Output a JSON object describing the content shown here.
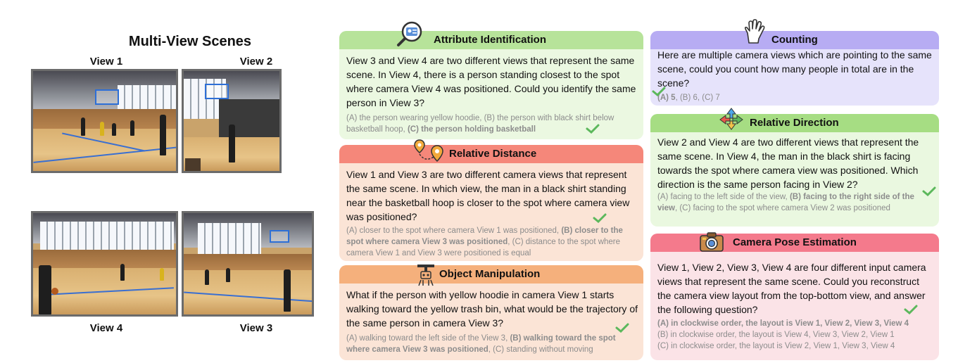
{
  "scenes": {
    "title": "Multi-View Scenes",
    "view1": "View 1",
    "view2": "View 2",
    "view3": "View 3",
    "view4": "View 4"
  },
  "colors": {
    "attribute_header": "#b7e39a",
    "distance_header": "#f5877a",
    "manipulation_header": "#f5b07c",
    "counting_header": "#b7acf3",
    "direction_header": "#a6dd83",
    "camera_header": "#f47a8c",
    "check": "#5cb85c"
  },
  "icons": {
    "attribute": "magnifier-id-card-icon",
    "distance": "map-pins-icon",
    "manipulation": "robot-arm-icon",
    "counting": "hand-counting-icon",
    "direction": "direction-arrows-icon",
    "camera": "camera-icon",
    "answer_marker": "check-icon"
  },
  "cards": {
    "attribute": {
      "title": "Attribute Identification",
      "question": "View 3 and View 4 are two different views that represent the same scene. In View 4, there is a person standing closest to the spot where camera View 4 was positioned. Could you identify the same person in View 3?",
      "opt_a": "(A) the person wearing yellow hoodie, (B) the person with black shirt below basketball hoop, ",
      "opt_c": "(C) the person holding basketball"
    },
    "distance": {
      "title": "Relative Distance",
      "question": "View 1 and View 3 are two different camera views that represent the same scene. In which view, the man in a black shirt standing near the basketball hoop is closer to the spot where camera view was positioned?",
      "opt_a": "(A) closer to the spot where camera View 1 was positioned, ",
      "opt_b": "(B) closer to the spot where camera View 3 was positioned",
      "opt_c": ", (C) distance to the spot where camera View 1 and View 3 were positioned is equal"
    },
    "manipulation": {
      "title": "Object Manipulation",
      "question": "What if the person with yellow hoodie in camera View 1 starts walking toward the yellow trash bin, what would be the trajectory of the same person in camera View 3?",
      "opt_a": "(A) walking toward the left side of the View 3, ",
      "opt_b": "(B) walking toward the spot where camera View 3 was positioned",
      "opt_c": ", (C) standing without moving"
    },
    "counting": {
      "title": "Counting",
      "question": "Here are multiple camera views which are pointing to the same scene, could you count how many people in total are in the scene?",
      "opt_a": "(A) 5",
      "opt_rest": ", (B) 6, (C) 7"
    },
    "direction": {
      "title": "Relative Direction",
      "question": "View 2 and View 4 are two different views that represent the same scene. In View 4, the man in the black shirt is facing towards the spot where camera view was positioned. Which direction is the same person facing in View 2?",
      "opt_a": "(A) facing to the left side of the view, ",
      "opt_b": "(B) facing to the right side of the view",
      "opt_c": ", (C) facing to the spot where camera View 2 was positioned"
    },
    "camera": {
      "title": "Camera Pose Estimation",
      "question": "View 1, View 2, View 3, View 4 are four different input camera views that represent the same scene. Could you reconstruct the camera view layout from the top-bottom view, and answer the following question?",
      "opt_a": "(A) in clockwise order, the layout is View 1, View 2, View 3, View 4",
      "opt_b": "(B) in clockwise order, the layout is View 4, View 3, View 2, View 1",
      "opt_c": "(C) in clockwise order, the layout is View 2, View 1, View 3, View 4"
    }
  }
}
